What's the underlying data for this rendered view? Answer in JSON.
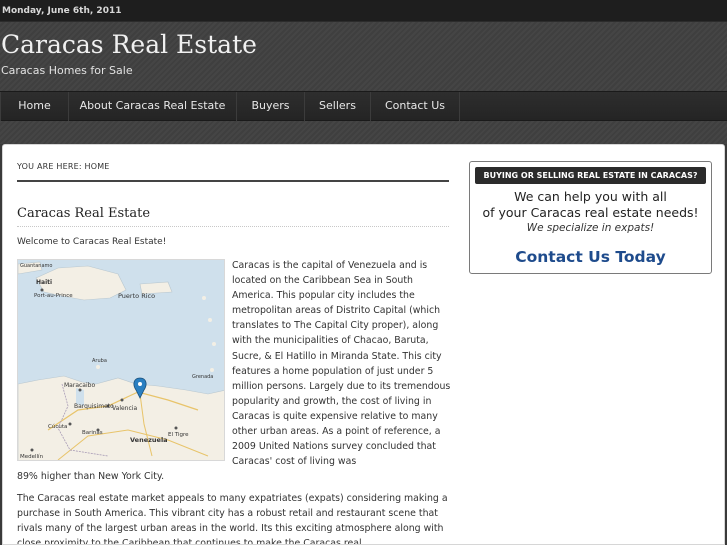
{
  "topbar": {
    "date": "Monday, June 6th, 2011"
  },
  "header": {
    "title": "Caracas Real Estate",
    "tagline": "Caracas Homes for Sale"
  },
  "nav": {
    "items": [
      {
        "label": "Home"
      },
      {
        "label": "About Caracas Real Estate"
      },
      {
        "label": "Buyers"
      },
      {
        "label": "Sellers"
      },
      {
        "label": "Contact Us"
      }
    ]
  },
  "breadcrumb": {
    "text": "YOU ARE HERE: HOME"
  },
  "post": {
    "title": "Caracas Real Estate",
    "welcome": "Welcome to Caracas Real Estate!",
    "paragraph1": "Caracas is the capital of Venezuela and is located on the Caribbean Sea in South America.  This popular city includes the metropolitan areas of Distrito Capital (which translates to The Capital City proper), along with the municipalities of Chacao, Baruta, Sucre, & El Hatillo in Miranda State.  This city features a home population of just under 5 million persons.  Largely due to its tremendous popularity and growth, the cost of living in Caracas is quite expensive relative to many other urban areas.  As a point of reference, a 2009 United Nations survey concluded that Caracas' cost of living was",
    "paragraph1_tail": "89% higher than New York City.",
    "paragraph2": "The Caracas real estate market appeals to many expatriates (expats) considering making a purchase in South America.  This vibrant city has a robust retail and restaurant scene that rivals many of the largest urban areas in the world.  Its this exciting atmosphere along with close proximity to the Caribbean that continues to make the Caracas real",
    "map": {
      "labels": {
        "haiti": "Haiti",
        "port_au_prince": "Port-au-Prince",
        "puerto_rico": "Puerto Rico",
        "guantanamo": "Guantanamo",
        "aruba": "Aruba",
        "maracaibo": "Maracaibo",
        "barquisimeto": "Barquisimeto",
        "valencia": "Valencia",
        "cucuta": "Cúcuta",
        "barinas": "Barinas",
        "venezuela": "Venezuela",
        "el_tigre": "El Tigre",
        "medellin": "Medellín",
        "grenada": "Grenada"
      },
      "colors": {
        "sea": "#cfe0ec",
        "land": "#f3efe5",
        "pin": "#2a7fc1"
      }
    }
  },
  "sidebar": {
    "widget": {
      "title": "BUYING OR SELLING REAL ESTATE IN CARACAS?",
      "line1": "We can help you with all",
      "line2": "of your Caracas real estate needs!",
      "line3": "We specialize in expats!",
      "cta": "Contact Us Today"
    }
  }
}
